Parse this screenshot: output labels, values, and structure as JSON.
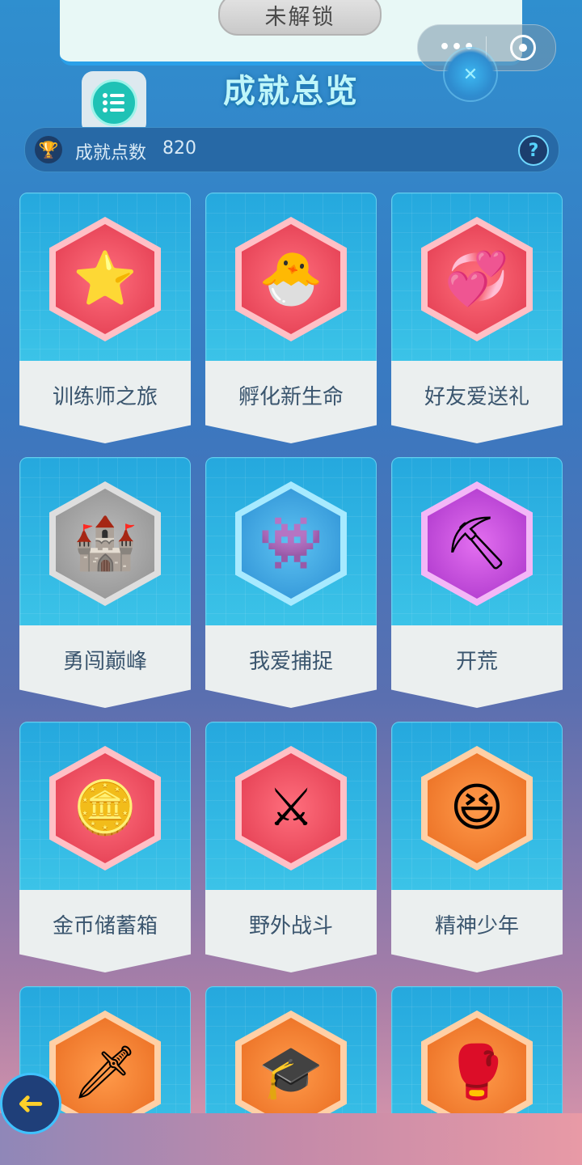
{
  "header": {
    "locked_label": "未解锁",
    "title": "成就总览",
    "capsule_dots": "•••"
  },
  "points": {
    "label": "成就点数",
    "value": "820",
    "help": "?"
  },
  "cards": [
    {
      "label": "训练师之旅",
      "icon": "star-badge-icon",
      "glyph": "⭐"
    },
    {
      "label": "孵化新生命",
      "icon": "hatching-chick-icon",
      "glyph": "🐣"
    },
    {
      "label": "好友爱送礼",
      "icon": "bunny-friends-icon",
      "glyph": "💞"
    },
    {
      "label": "勇闯巅峰",
      "icon": "castle-shield-icon",
      "glyph": "🏰"
    },
    {
      "label": "我爱捕捉",
      "icon": "purple-monster-icon",
      "glyph": "👾"
    },
    {
      "label": "开荒",
      "icon": "pickaxe-crystal-icon",
      "glyph": "⛏"
    },
    {
      "label": "金币储蓄箱",
      "icon": "gold-coin-icon",
      "glyph": "🪙"
    },
    {
      "label": "野外战斗",
      "icon": "crossed-swords-crown-icon",
      "glyph": "⚔"
    },
    {
      "label": "精神少年",
      "icon": "laughing-boy-clock-icon",
      "glyph": "😆"
    },
    {
      "label": "",
      "icon": "winged-sword-icon",
      "glyph": "🗡"
    },
    {
      "label": "",
      "icon": "graduate-monster-icon",
      "glyph": "🎓"
    },
    {
      "label": "",
      "icon": "boxing-gloves-icon",
      "glyph": "🥊"
    }
  ],
  "back": {
    "glyph": "➜"
  }
}
